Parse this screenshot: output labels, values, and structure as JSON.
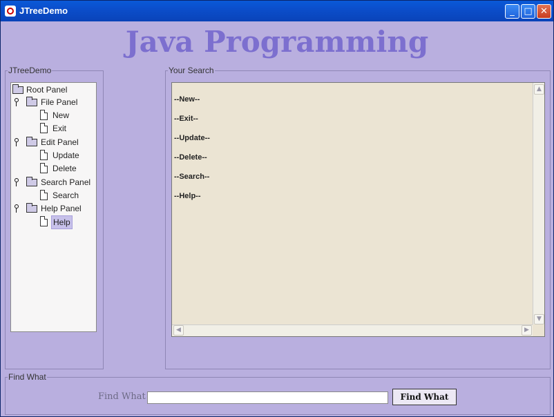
{
  "window": {
    "title": "JTreeDemo",
    "controls": {
      "minimize": "_",
      "maximize": "□",
      "close": "✕"
    }
  },
  "heading": "Java Programming",
  "tree_panel": {
    "legend": "JTreeDemo",
    "root": "Root Panel",
    "nodes": [
      {
        "label": "File Panel",
        "children": [
          "New",
          "Exit"
        ]
      },
      {
        "label": "Edit Panel",
        "children": [
          "Update",
          "Delete"
        ]
      },
      {
        "label": "Search Panel",
        "children": [
          "Search"
        ]
      },
      {
        "label": "Help Panel",
        "children": [
          "Help"
        ]
      }
    ],
    "selected": "Help"
  },
  "search_panel": {
    "legend": "Your Search",
    "lines": [
      "--New--",
      "--Exit--",
      "--Update--",
      "--Delete--",
      "--Search--",
      "--Help--"
    ]
  },
  "find_panel": {
    "legend": "Find What",
    "label": "Find What",
    "input_value": "",
    "button_label": "Find What"
  },
  "colors": {
    "background": "#b9afdf",
    "heading": "#7c6fcf",
    "textarea": "#ebe4d3",
    "titlebar": "#0b4ecb"
  }
}
